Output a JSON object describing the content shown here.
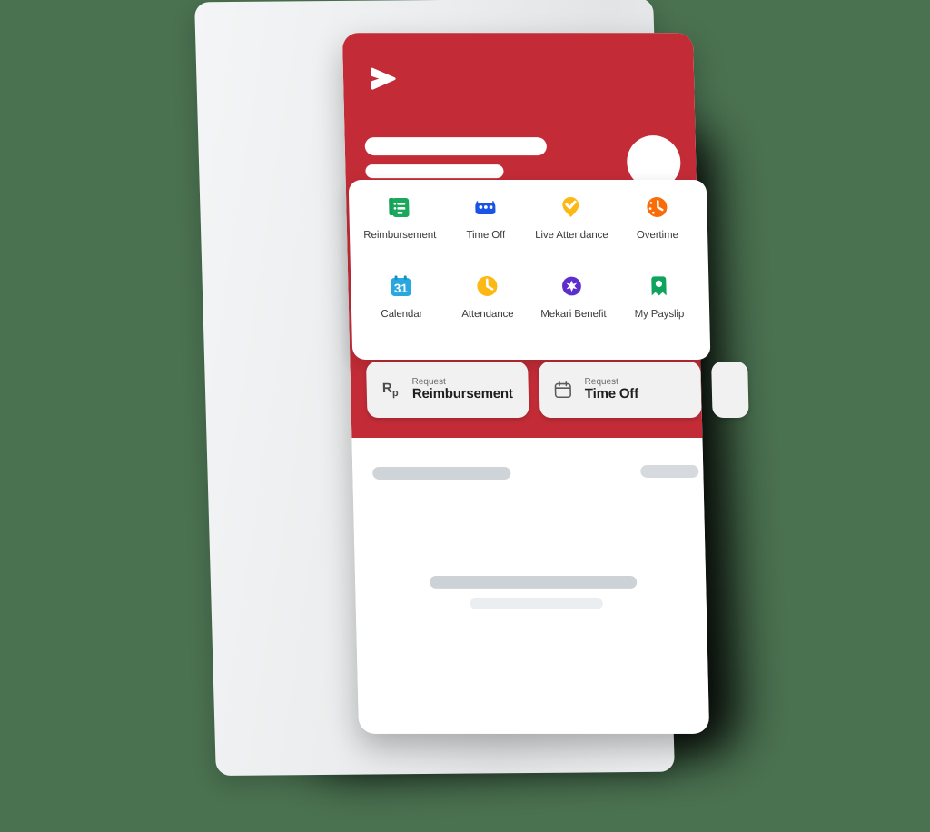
{
  "colors": {
    "background": "#4a7150",
    "brand_red": "#c32c37",
    "card_white": "#ffffff",
    "back_card_gray": "#ebedee",
    "skeleton_gray": "#cfd4d8",
    "quick_action_bg": "#f1f1f2"
  },
  "header": {
    "logo_icon": "mekari-talenta-chevron-logo",
    "name_placeholder": "",
    "role_placeholder": "",
    "avatar_icon": "user-avatar-placeholder"
  },
  "menu_grid": {
    "items": [
      {
        "label": "Reimbursement",
        "icon": "receipt-document-icon",
        "color": "#1aa85c"
      },
      {
        "label": "Time Off",
        "icon": "suitcase-icon",
        "color": "#1a53e8"
      },
      {
        "label": "Live Attendance",
        "icon": "location-pin-check-icon",
        "color": "#fcb813"
      },
      {
        "label": "Overtime",
        "icon": "clock-dots-icon",
        "color": "#f96c08"
      },
      {
        "label": "Calendar",
        "icon": "calendar-31-icon",
        "color": "#29a8e0"
      },
      {
        "label": "Attendance",
        "icon": "clock-icon",
        "color": "#fcb813"
      },
      {
        "label": "Mekari Benefit",
        "icon": "benefit-star-icon",
        "color": "#5b2ecd"
      },
      {
        "label": "My Payslip",
        "icon": "payslip-bookmark-icon",
        "color": "#0fa45e"
      }
    ]
  },
  "quick_actions": {
    "cards": [
      {
        "sub": "Request",
        "main": "Reimbursement",
        "icon": "rupiah-icon"
      },
      {
        "sub": "Request",
        "main": "Time Off",
        "icon": "calendar-icon"
      },
      {
        "sub": "",
        "main": "",
        "icon": "partial-card-icon"
      }
    ]
  },
  "body": {
    "skeleton_rows": [
      "",
      "",
      "",
      ""
    ]
  }
}
